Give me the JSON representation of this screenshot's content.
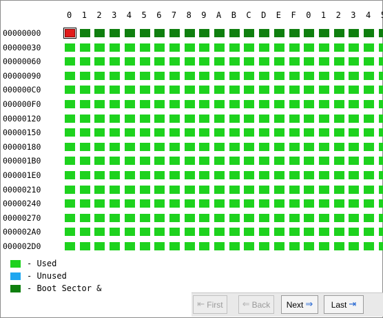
{
  "header": {
    "columns": [
      "0",
      "1",
      "2",
      "3",
      "4",
      "5",
      "6",
      "7",
      "8",
      "9",
      "A",
      "B",
      "C",
      "D",
      "E",
      "F",
      "0",
      "1",
      "2",
      "3",
      "4",
      "5"
    ]
  },
  "rows": [
    {
      "offset": "00000000"
    },
    {
      "offset": "00000030"
    },
    {
      "offset": "00000060"
    },
    {
      "offset": "00000090"
    },
    {
      "offset": "000000C0"
    },
    {
      "offset": "000000F0"
    },
    {
      "offset": "00000120"
    },
    {
      "offset": "00000150"
    },
    {
      "offset": "00000180"
    },
    {
      "offset": "000001B0"
    },
    {
      "offset": "000001E0"
    },
    {
      "offset": "00000210"
    },
    {
      "offset": "00000240"
    },
    {
      "offset": "00000270"
    },
    {
      "offset": "000002A0"
    },
    {
      "offset": "000002D0"
    }
  ],
  "grid": {
    "row_count": 16,
    "column_count": 22,
    "first_row_state": "boot",
    "selected_cell": {
      "row": 0,
      "col": 0
    },
    "default_state": "used"
  },
  "legend": {
    "items": [
      {
        "label": "- Used",
        "color": "#1ed21e"
      },
      {
        "label": "- Unused",
        "color": "#1fa7f0"
      },
      {
        "label": "- Boot Sector &",
        "color": "#0f7f0f"
      }
    ]
  },
  "nav": {
    "first_label": "First",
    "back_label": "Back",
    "next_label": "Next",
    "last_label": "Last"
  },
  "colors": {
    "used": "#1ed21e",
    "unused": "#1fa7f0",
    "boot": "#0f7f0f",
    "selected": "#e11b1b"
  }
}
